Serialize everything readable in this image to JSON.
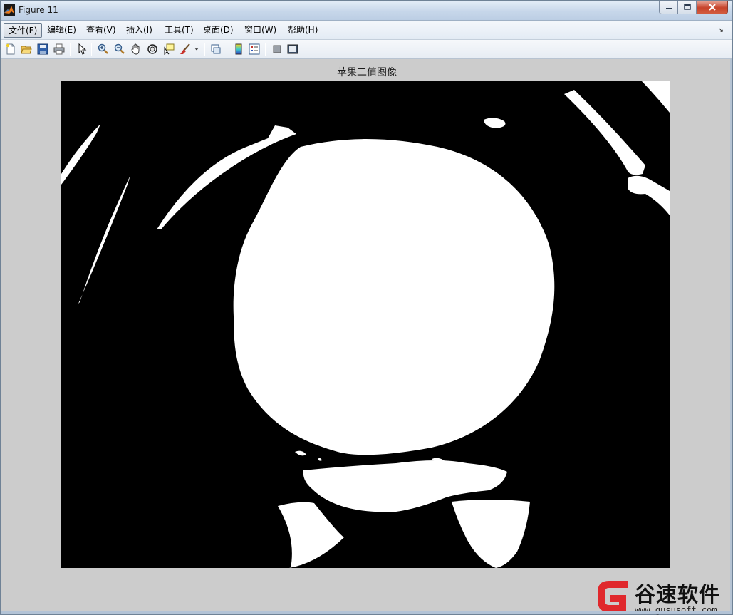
{
  "window": {
    "title": "Figure 11",
    "caption_buttons": {
      "minimize": "minimize",
      "maximize": "maximize",
      "close": "close"
    }
  },
  "menubar": {
    "items": [
      {
        "label": "文件(F)",
        "active": true
      },
      {
        "label": "编辑(E)"
      },
      {
        "label": "查看(V)"
      },
      {
        "label": "插入(I)"
      },
      {
        "label": "工具(T)"
      },
      {
        "label": "桌面(D)"
      },
      {
        "label": "窗口(W)"
      },
      {
        "label": "帮助(H)"
      }
    ],
    "overflow_glyph": "↘"
  },
  "toolbar": {
    "buttons": [
      {
        "name": "new-figure-icon"
      },
      {
        "name": "open-file-icon"
      },
      {
        "name": "save-icon"
      },
      {
        "name": "print-icon"
      },
      {
        "name": "edit-plot-arrow-icon"
      },
      {
        "name": "zoom-in-icon"
      },
      {
        "name": "zoom-out-icon"
      },
      {
        "name": "pan-hand-icon"
      },
      {
        "name": "rotate-3d-icon"
      },
      {
        "name": "data-cursor-icon"
      },
      {
        "name": "brush-icon"
      },
      {
        "name": "link-plot-icon"
      },
      {
        "name": "insert-colorbar-icon"
      },
      {
        "name": "insert-legend-icon"
      },
      {
        "name": "hide-plot-tools-icon"
      },
      {
        "name": "show-plot-tools-icon"
      }
    ]
  },
  "plot": {
    "title": "苹果二值图像",
    "image_type": "binary",
    "foreground_color": "#ffffff",
    "background_color": "#000000"
  },
  "watermark": {
    "brand": "谷速软件",
    "url": "www.gususoft.com",
    "logo_color": "#e0282c"
  }
}
